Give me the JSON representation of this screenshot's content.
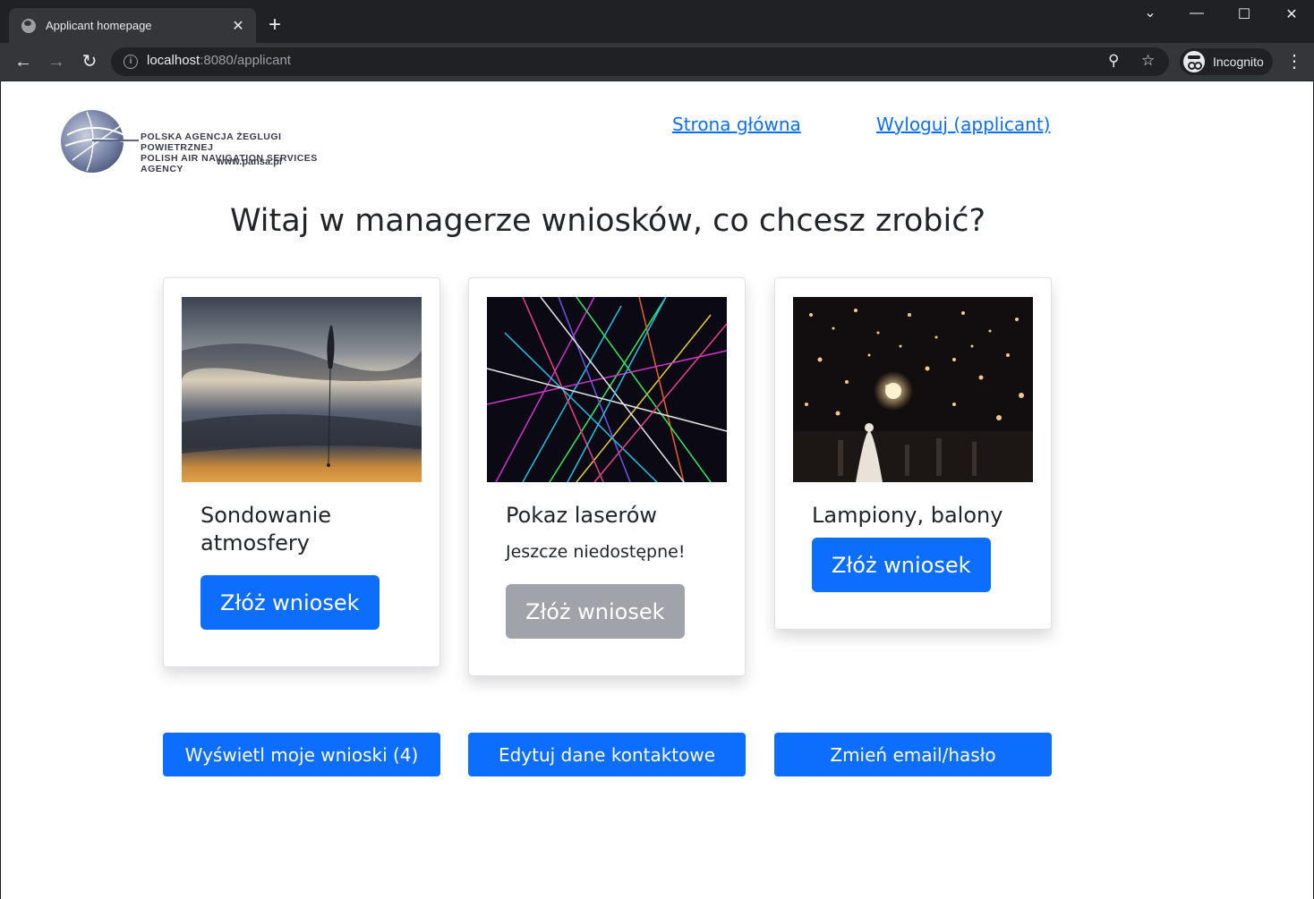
{
  "browser": {
    "tab_title": "Applicant homepage",
    "url_host": "localhost",
    "url_rest": ":8080/applicant",
    "profile_label": "Incognito"
  },
  "header": {
    "logo": {
      "line1": "POLSKA AGENCJA ŻEGLUGI POWIETRZNEJ",
      "line2": "POLISH AIR NAVIGATION SERVICES AGENCY",
      "www": "www.pansa.pl"
    },
    "nav": {
      "home": "Strona główna",
      "logout": "Wyloguj (applicant)"
    }
  },
  "main": {
    "heading": "Witaj w managerze wniosków, co chcesz zrobić?",
    "cards": [
      {
        "title": "Sondowanie atmosfery",
        "button": "Złóż wniosek"
      },
      {
        "title": "Pokaz laserów",
        "note": "Jeszcze niedostępne!",
        "button": "Złóż wniosek"
      },
      {
        "title": "Lampiony, balony",
        "button": "Złóż wniosek"
      }
    ],
    "actions": {
      "my_requests": "Wyświetl moje wnioski (4)",
      "edit_contact": "Edytuj dane kontaktowe",
      "change_credentials": "Zmień email/hasło"
    }
  },
  "colors": {
    "primary": "#0d6efd",
    "disabled": "#a0a4aa",
    "chrome_bg": "#202124"
  }
}
